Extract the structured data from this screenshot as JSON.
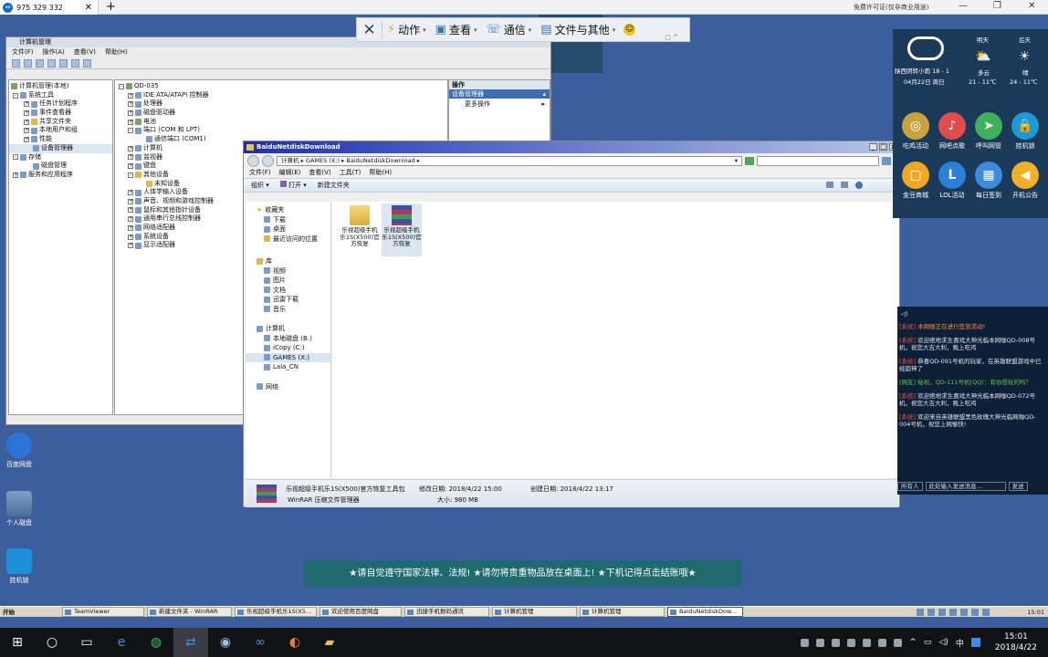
{
  "tv": {
    "tab_label": "975 329 332",
    "license": "免费许可证(仅非商业用途)",
    "toolbar": {
      "action": "动作",
      "view": "查看",
      "comm": "通信",
      "files": "文件与其他"
    }
  },
  "comp_mgmt": {
    "title": "计算机管理",
    "menu": [
      "文件(F)",
      "操作(A)",
      "查看(V)",
      "帮助(H)"
    ],
    "left_tree": [
      {
        "label": "计算机管理(本地)",
        "level": 0
      },
      {
        "label": "系统工具",
        "level": 1
      },
      {
        "label": "任务计划程序",
        "level": 2
      },
      {
        "label": "事件查看器",
        "level": 2
      },
      {
        "label": "共享文件夹",
        "level": 2
      },
      {
        "label": "本地用户和组",
        "level": 2
      },
      {
        "label": "性能",
        "level": 2
      },
      {
        "label": "设备管理器",
        "level": 2
      },
      {
        "label": "存储",
        "level": 1
      },
      {
        "label": "磁盘管理",
        "level": 2
      },
      {
        "label": "服务和应用程序",
        "level": 1
      }
    ],
    "device_tree": [
      {
        "label": "QD-035",
        "level": 0
      },
      {
        "label": "IDE ATA/ATAPI 控制器",
        "level": 1
      },
      {
        "label": "处理器",
        "level": 1
      },
      {
        "label": "磁盘驱动器",
        "level": 1
      },
      {
        "label": "电池",
        "level": 1
      },
      {
        "label": "端口 (COM 和 LPT)",
        "level": 1
      },
      {
        "label": "通信端口 (COM1)",
        "level": 2
      },
      {
        "label": "计算机",
        "level": 1
      },
      {
        "label": "监视器",
        "level": 1
      },
      {
        "label": "键盘",
        "level": 1
      },
      {
        "label": "其他设备",
        "level": 1
      },
      {
        "label": "未知设备",
        "level": 2
      },
      {
        "label": "人体学输入设备",
        "level": 1
      },
      {
        "label": "声音、视频和游戏控制器",
        "level": 1
      },
      {
        "label": "鼠标和其他指针设备",
        "level": 1
      },
      {
        "label": "通用串行总线控制器",
        "level": 1
      },
      {
        "label": "网络适配器",
        "level": 1
      },
      {
        "label": "系统设备",
        "level": 1
      },
      {
        "label": "显示适配器",
        "level": 1
      }
    ],
    "actions_header": "操作",
    "actions_selected": "设备管理器",
    "actions_more": "更多操作"
  },
  "explorer": {
    "title": "BaiduNetdiskDownload",
    "address": [
      "计算机",
      "GAMES (X:)",
      "BaiduNetdiskDownload"
    ],
    "menu": [
      "文件(F)",
      "编辑(E)",
      "查看(V)",
      "工具(T)",
      "帮助(H)"
    ],
    "commands": [
      "组织",
      "打开",
      "新建文件夹"
    ],
    "nav": {
      "favorites": "收藏夹",
      "favorites_items": [
        "下载",
        "桌面",
        "最近访问的位置"
      ],
      "libraries": "库",
      "libraries_items": [
        "视频",
        "图片",
        "文档",
        "迅雷下载",
        "音乐"
      ],
      "computer": "计算机",
      "computer_items": [
        "本地磁盘 (B:)",
        "iCopy (C:)",
        "GAMES (X:)",
        "Lala_CN"
      ],
      "network": "网络"
    },
    "files": [
      {
        "name": "乐视超级手机乐1S(X500)官方恢复",
        "kind": "folder"
      },
      {
        "name": "乐视超级手机乐1S(X500)官方恢复",
        "kind": "rar"
      }
    ],
    "details": {
      "name": "乐视超级手机乐1S(X500)官方恢复工具包",
      "type": "WinRAR 压缩文件管理器",
      "modified_label": "修改日期:",
      "modified": "2018/4/22 15:00",
      "created_label": "创建日期:",
      "created": "2018/4/22 13:17",
      "size_label": "大小:",
      "size": "980 MB"
    }
  },
  "widget": {
    "weather_now": "陕西阴转小雨 18 - 1",
    "date": "04月22日 周日",
    "day1": "明天",
    "day1_cond": "多云",
    "day1_temp": "21 - 11℃",
    "day2": "后天",
    "day2_cond": "晴",
    "day2_temp": "24 - 11℃",
    "apps": [
      "吃鸡活动",
      "网吧点歌",
      "呼叫网管",
      "挂机锁",
      "金豆商城",
      "LOL活动",
      "每日签到",
      "开机公告"
    ]
  },
  "chat": {
    "messages": [
      {
        "channel": "[系统]",
        "text": "本网咖正在进行签到活动!"
      },
      {
        "channel": "[系统]",
        "text": "欢迎绝地求生喜戏大神光临本网咖QD-008号机，祝您大吉大利，晚上吃鸡"
      },
      {
        "channel": "[系统]",
        "text": "恭喜QD-091号机的玩家，在英雄联盟游戏中已经超神了"
      },
      {
        "channel": "[网友]",
        "text": "秘视，QD-111号机(QQ)：有你想玩的吗？"
      },
      {
        "channel": "[系统]",
        "text": "欢迎绝地求生喜戏大神光临本网咖QD-072号机，祝您大吉大利，晚上吃鸡"
      },
      {
        "channel": "[系统]",
        "text": "欢迎来自英雄联盟黑色玫瑰大神光临网咖QD-004号机，祝您上网愉快!"
      }
    ],
    "all_people": "所有人",
    "input_placeholder": "此处输入发送消息...",
    "send": "发送"
  },
  "desktop_icons": [
    "百度网盘",
    "个人磁盘",
    "挂机锁"
  ],
  "notice": "★请自觉遵守国家法律、法规! ★请勿将贵重物品放在桌面上! ★下机记得点击结账哦★",
  "remote_taskbar": {
    "start": "开始",
    "tasks": [
      "TeamViewer",
      "新建文件夹 - WinRAR",
      "乐视超级手机乐1S(X5...",
      "欢迎使用百度网盘",
      "迅捷手机数码通讯",
      "计算机管理",
      "计算机管理",
      "BaiduNetdiskDow..."
    ],
    "clock": "15:01"
  },
  "w10": {
    "ime": "中",
    "time": "15:01",
    "date": "2018/4/22"
  }
}
